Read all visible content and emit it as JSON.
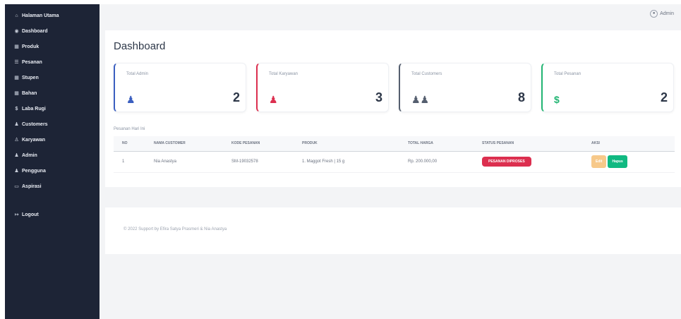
{
  "sidebar": {
    "items": [
      {
        "icon": "home-icon",
        "glyph": "⌂",
        "label": "Halaman Utama"
      },
      {
        "icon": "dashboard-icon",
        "glyph": "◉",
        "label": "Dashboard"
      },
      {
        "icon": "grid-icon",
        "glyph": "▦",
        "label": "Produk"
      },
      {
        "icon": "list-icon",
        "glyph": "☰",
        "label": "Pesanan"
      },
      {
        "icon": "grid-icon",
        "glyph": "▦",
        "label": "Stupen"
      },
      {
        "icon": "grid-icon",
        "glyph": "▦",
        "label": "Bahan"
      },
      {
        "icon": "dollar-icon",
        "glyph": "$",
        "label": "Laba Rugi"
      },
      {
        "icon": "users-icon",
        "glyph": "♟",
        "label": "Customers"
      },
      {
        "icon": "user-icon",
        "glyph": "♙",
        "label": "Karyawan"
      },
      {
        "icon": "users-icon",
        "glyph": "♟",
        "label": "Admin"
      },
      {
        "icon": "users-icon",
        "glyph": "♟",
        "label": "Pengguna"
      },
      {
        "icon": "chat-icon",
        "glyph": "▭",
        "label": "Aspirasi"
      }
    ],
    "logout": {
      "icon": "logout-icon",
      "glyph": "↦",
      "label": "Logout"
    }
  },
  "topbar": {
    "user_label": "Admin",
    "user_icon": "user-circle-icon"
  },
  "page_title": "Dashboard",
  "cards": [
    {
      "label": "Total Admin",
      "value": "2",
      "icon": "user-gear-icon",
      "glyph": "♟",
      "color": "#3b5fc0"
    },
    {
      "label": "Total Karyawan",
      "value": "3",
      "icon": "user-tie-icon",
      "glyph": "♟",
      "color": "#dc2f4f"
    },
    {
      "label": "Total Customers",
      "value": "8",
      "icon": "users-icon",
      "glyph": "♟♟",
      "color": "#555f6f"
    },
    {
      "label": "Total Pesanan",
      "value": "2",
      "icon": "dollar-icon",
      "glyph": "$",
      "color": "#22b573"
    }
  ],
  "orders_label": "Pesanan Hari Ini",
  "table": {
    "headers": [
      "NO",
      "NAMA CUSTOMER",
      "KODE PESANAN",
      "PRODUK",
      "TOTAL HARGA",
      "STATUS PESANAN",
      "AKSI"
    ],
    "rows": [
      {
        "no": "1",
        "customer": "Nia Anastya",
        "code": "SM-19032578",
        "product": "1. Maggot Fresh | 15 g",
        "total": "Rp. 200.000,00",
        "status": "PESANAN DIPROSES",
        "edit": "Edit",
        "delete": "Hapus"
      }
    ]
  },
  "footer": "© 2022 Support by Efira Satya Prasmeri & Nia Anastya",
  "colors": {
    "sidebar": "#1d2436",
    "status": "#dc2f4f",
    "edit_button": "#f7c98a",
    "delete_button": "#10b981"
  }
}
